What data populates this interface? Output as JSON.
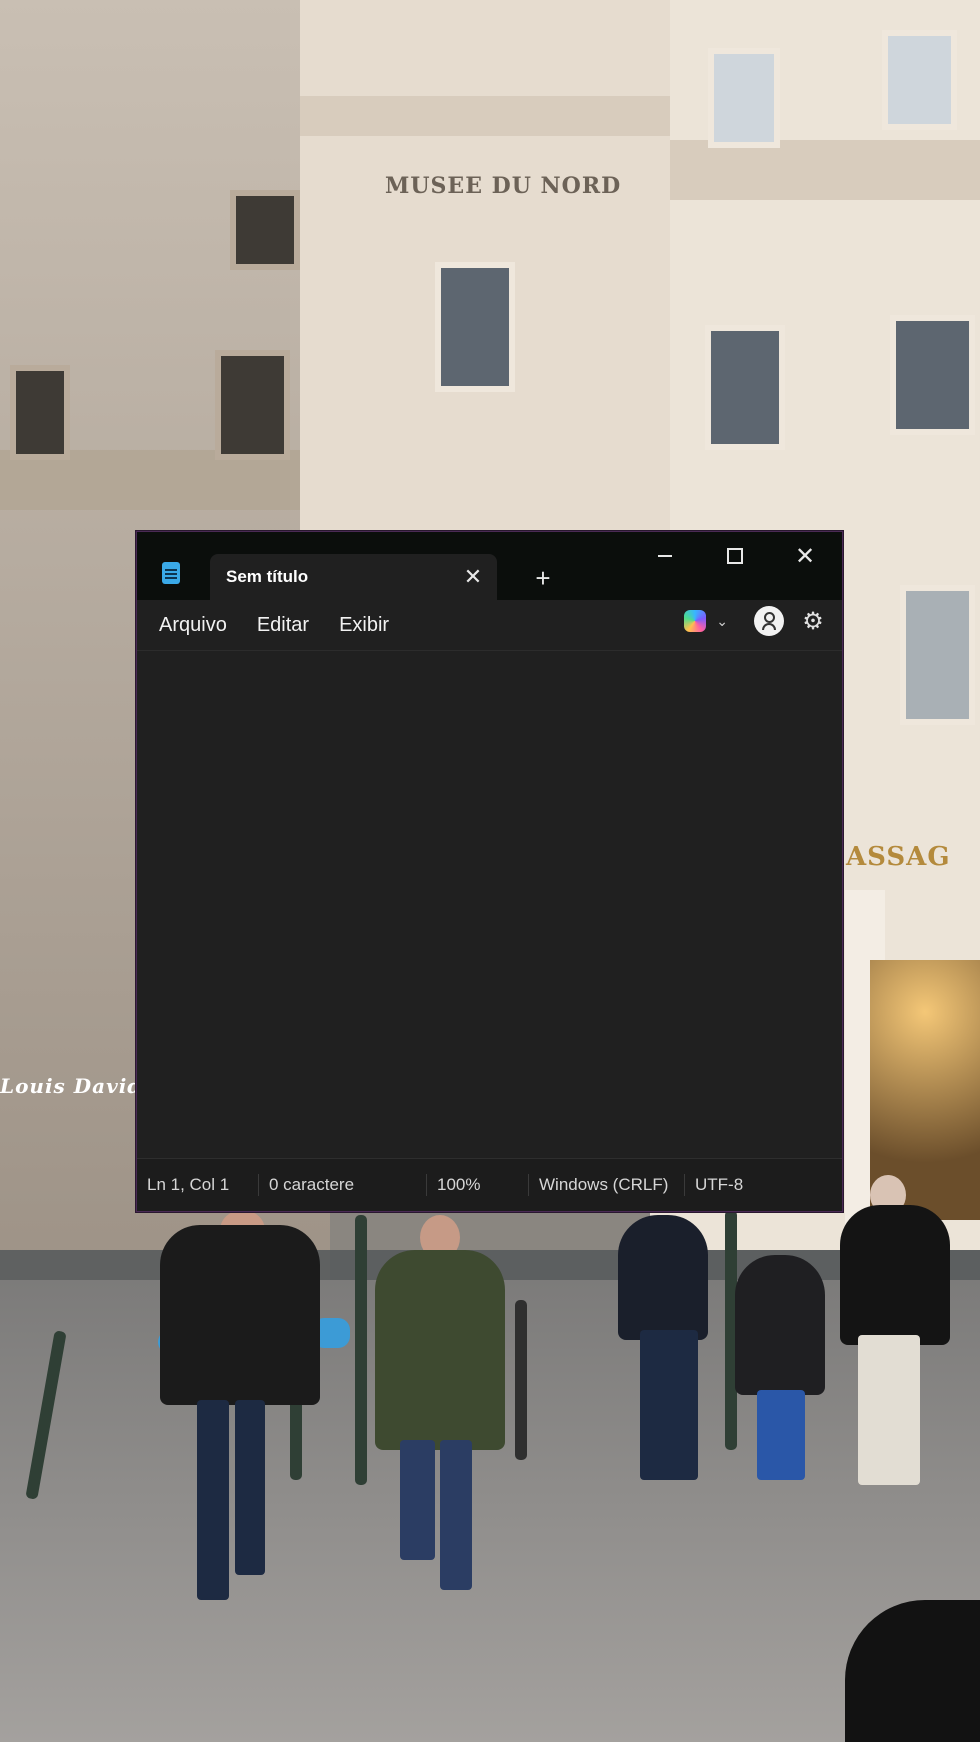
{
  "background": {
    "building_sign": "MUSEE DU NORD",
    "arcade_sign": "ASSAG",
    "shop_sign": "Louis David"
  },
  "window": {
    "tab_title": "Sem título",
    "tab_close_icon": "close-icon",
    "new_tab_icon": "plus-icon",
    "controls": {
      "minimize_icon": "minimize-icon",
      "maximize_icon": "maximize-icon",
      "close_icon": "close-icon"
    }
  },
  "menu": {
    "items": [
      "Arquivo",
      "Editar",
      "Exibir"
    ],
    "right_icons": [
      "copilot-icon",
      "chevron-down-icon",
      "account-icon",
      "gear-icon"
    ]
  },
  "editor": {
    "content": ""
  },
  "status": {
    "position": "Ln 1, Col 1",
    "chars": "0 caractere",
    "zoom": "100%",
    "line_ending": "Windows (CRLF)",
    "encoding": "UTF-8"
  },
  "colors": {
    "titlebar": "#0b0e0c",
    "editor_bg": "#202020",
    "accent_border": "#4a2a55"
  }
}
